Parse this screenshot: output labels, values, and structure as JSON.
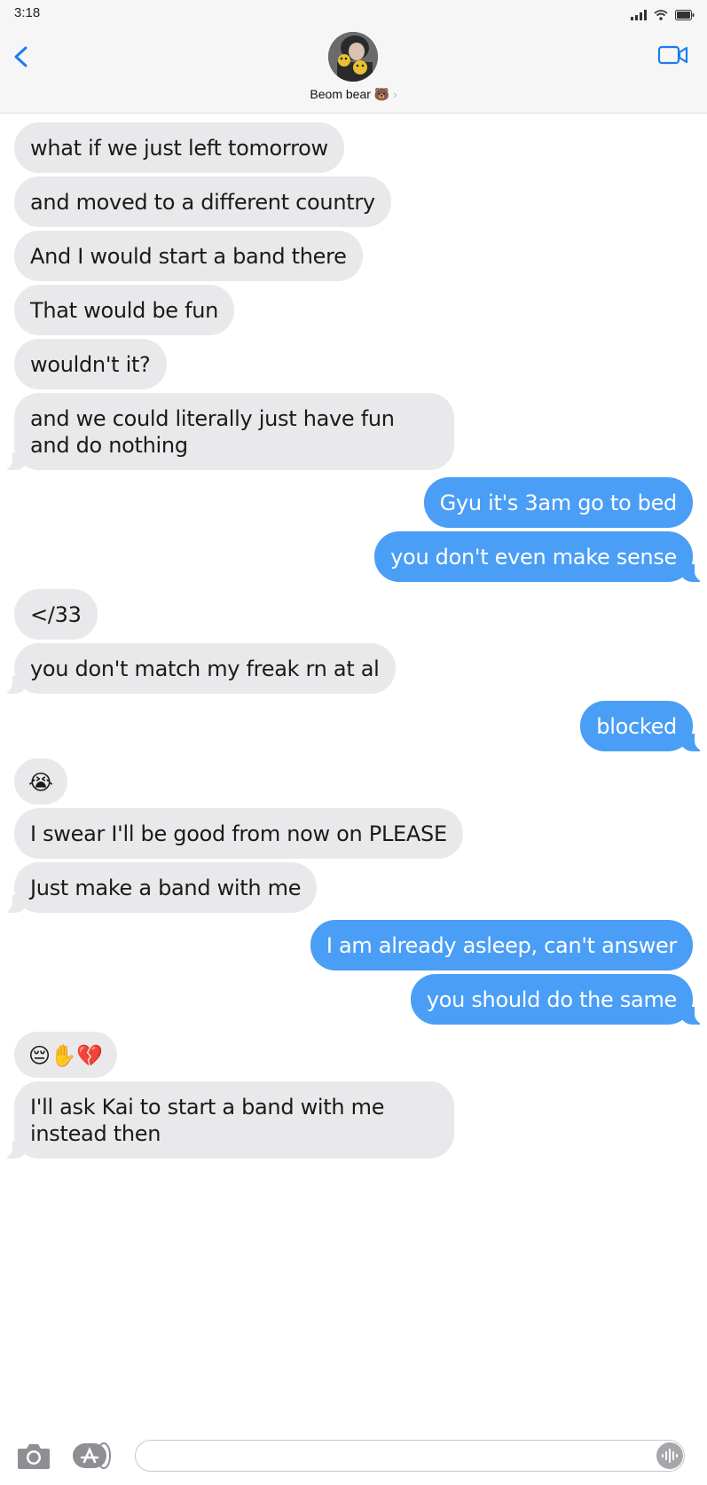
{
  "status_bar": {
    "time": "3:18"
  },
  "header": {
    "contact_name": "Beom bear 🐻",
    "chevron": "›"
  },
  "icons": {
    "back": "chevron-left-icon",
    "video": "video-camera-icon",
    "camera": "camera-icon",
    "apps": "app-store-icon",
    "audio": "audio-waveform-icon",
    "signal": "cellular-signal-icon",
    "wifi": "wifi-icon",
    "battery": "battery-icon"
  },
  "colors": {
    "accent": "#1b7cf0",
    "outgoing_bubble": "#4a9ef5",
    "incoming_bubble": "#e9e9eb",
    "header_bg": "#f6f6f6"
  },
  "messages": [
    {
      "from": "them",
      "text": "what if we just left tomorrow"
    },
    {
      "from": "them",
      "text": "and moved to a different country"
    },
    {
      "from": "them",
      "text": "And I would start a band there"
    },
    {
      "from": "them",
      "text": "That would be fun"
    },
    {
      "from": "them",
      "text": "wouldn't it?"
    },
    {
      "from": "them",
      "text": "and we could literally just have fun and do nothing"
    },
    {
      "from": "me",
      "text": "Gyu it's 3am go to bed"
    },
    {
      "from": "me",
      "text": "you don't even make sense"
    },
    {
      "from": "them",
      "text": "</33"
    },
    {
      "from": "them",
      "text": "you don't match my freak rn at al"
    },
    {
      "from": "me",
      "text": "blocked"
    },
    {
      "from": "them",
      "text": "😭"
    },
    {
      "from": "them",
      "text": "I swear I'll be good from now on PLEASE"
    },
    {
      "from": "them",
      "text": "Just make a band with me"
    },
    {
      "from": "me",
      "text": "I am already asleep, can't answer"
    },
    {
      "from": "me",
      "text": "you should do the same"
    },
    {
      "from": "them",
      "text": "😔✋💔"
    },
    {
      "from": "them",
      "text": "I'll ask Kai to start a band with me instead then"
    }
  ],
  "compose": {
    "value": "",
    "placeholder": ""
  }
}
